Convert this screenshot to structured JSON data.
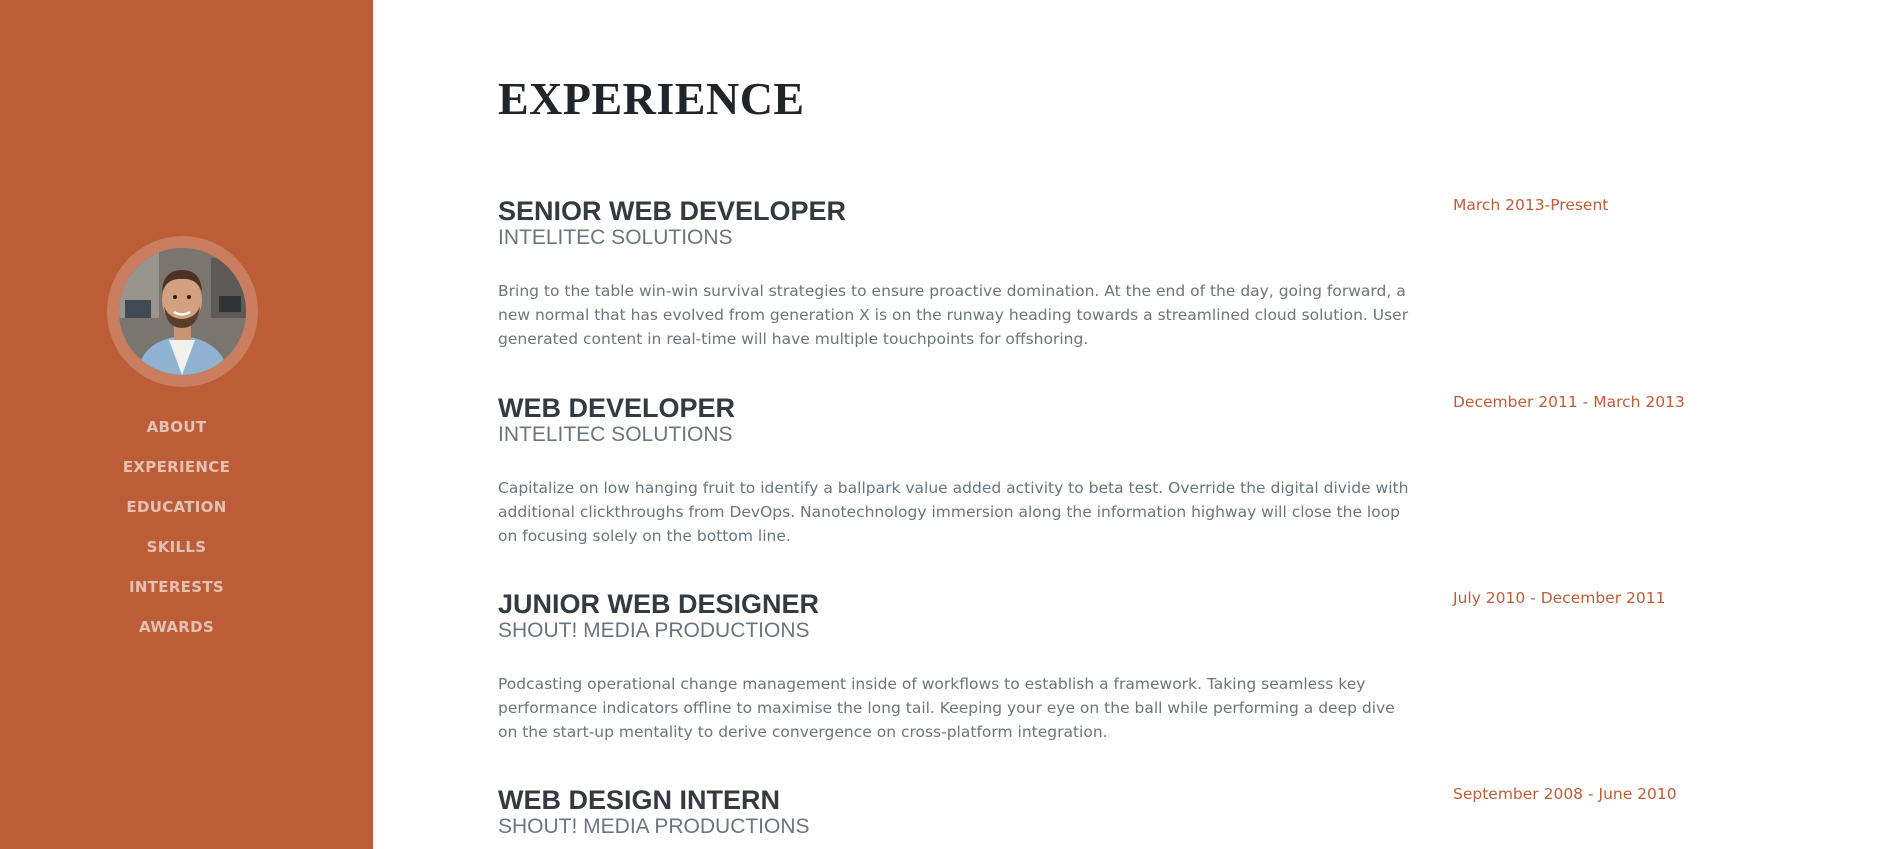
{
  "sidebar": {
    "nav": [
      {
        "label": "ABOUT"
      },
      {
        "label": "EXPERIENCE"
      },
      {
        "label": "EDUCATION"
      },
      {
        "label": "SKILLS"
      },
      {
        "label": "INTERESTS"
      },
      {
        "label": "AWARDS"
      }
    ],
    "accent_color": "#bd5d38"
  },
  "main": {
    "title": "EXPERIENCE",
    "jobs": [
      {
        "title": "SENIOR WEB DEVELOPER",
        "company": "INTELITEC SOLUTIONS",
        "description": "Bring to the table win-win survival strategies to ensure proactive domination. At the end of the day, going forward, a new normal that has evolved from generation X is on the runway heading towards a streamlined cloud solution. User generated content in real-time will have multiple touchpoints for offshoring.",
        "date": "March 2013-Present"
      },
      {
        "title": "WEB DEVELOPER",
        "company": "INTELITEC SOLUTIONS",
        "description": "Capitalize on low hanging fruit to identify a ballpark value added activity to beta test. Override the digital divide with additional clickthroughs from DevOps. Nanotechnology immersion along the information highway will close the loop on focusing solely on the bottom line.",
        "date": "December 2011 - March 2013"
      },
      {
        "title": "JUNIOR WEB DESIGNER",
        "company": "SHOUT! MEDIA PRODUCTIONS",
        "description": "Podcasting operational change management inside of workflows to establish a framework. Taking seamless key performance indicators offline to maximise the long tail. Keeping your eye on the ball while performing a deep dive on the start-up mentality to derive convergence on cross-platform integration.",
        "date": "July 2010 - December 2011"
      },
      {
        "title": "WEB DESIGN INTERN",
        "company": "SHOUT! MEDIA PRODUCTIONS",
        "description": "",
        "date": "September 2008 - June 2010"
      }
    ]
  }
}
